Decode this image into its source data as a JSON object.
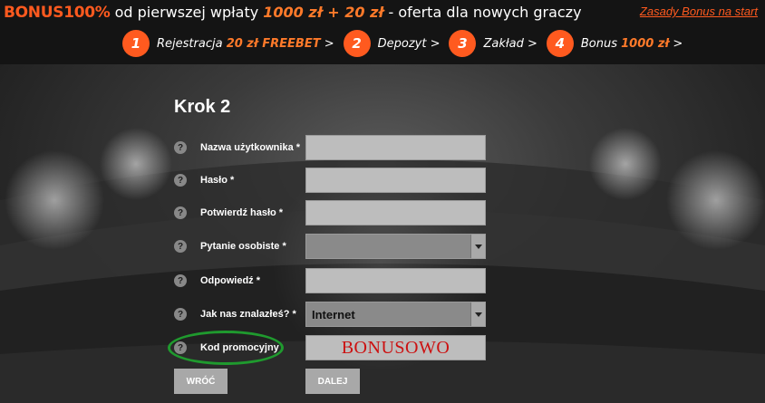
{
  "banner": {
    "bonus_label": "BONUS",
    "bonus_pct": "100%",
    "promo_mid": " od pierwszej wpłaty ",
    "promo_amount": "1000 zł + 20 zł",
    "promo_end": " - oferta dla nowych graczy",
    "rules_link": "Zasady Bonus na start",
    "steps": [
      {
        "num": "1",
        "text": "Rejestracja ",
        "highlight": "20 zł FREEBET",
        "arrow": " >"
      },
      {
        "num": "2",
        "text": "Depozyt",
        "highlight": "",
        "arrow": " >"
      },
      {
        "num": "3",
        "text": "Zakład",
        "highlight": "",
        "arrow": " >"
      },
      {
        "num": "4",
        "text": "Bonus ",
        "highlight": "1000 zł",
        "arrow": " >"
      }
    ]
  },
  "form": {
    "title": "Krok 2",
    "help_glyph": "?",
    "fields": [
      {
        "label": "Nazwa użytkownika *",
        "value": ""
      },
      {
        "label": "Hasło *",
        "value": ""
      },
      {
        "label": "Potwierdź hasło *",
        "value": ""
      },
      {
        "label": "Pytanie osobiste *",
        "value": ""
      },
      {
        "label": "Odpowiedź *",
        "value": ""
      },
      {
        "label": "Jak nas znalazłeś? *",
        "value": "Internet"
      },
      {
        "label": "Kod promocyjny",
        "value": "BONUSOWO"
      }
    ],
    "back_button": "WRÓĆ",
    "next_button": "DALEJ"
  },
  "colors": {
    "accent": "#ff5a1f",
    "promo_code": "#cc1111",
    "highlight_circle": "#1f9a2e"
  }
}
